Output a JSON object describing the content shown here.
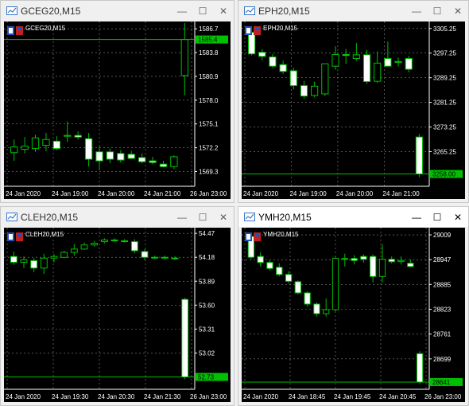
{
  "colors": {
    "background": "#000000",
    "bull_body": "#000000",
    "bear_body": "#ffffff",
    "wick": "#00c000",
    "bid_line": "#00c000",
    "grid": "#8a8a8a",
    "text": "#ffffff"
  },
  "windows": [
    {
      "title": "GCEG20,M15",
      "chart_label": "GCEG20,M15",
      "active": false,
      "controls": {
        "minimize": "—",
        "maximize": "☐",
        "close": "✕"
      },
      "chart_data": {
        "type": "candlestick",
        "title": "GCEG20,M15",
        "ylim": [
          1567.5,
          1587.4
        ],
        "y_ticks": [
          1586.7,
          1583.8,
          1580.9,
          1578.0,
          1575.1,
          1572.2,
          1569.3
        ],
        "x_ticks": [
          "24 Jan 2020",
          "24 Jan 19:00",
          "24 Jan 20:00",
          "24 Jan 21:00",
          "26 Jan 23:00"
        ],
        "last_price": "1585.4",
        "candles": [
          {
            "o": 1571.6,
            "h": 1573.2,
            "l": 1570.6,
            "c": 1572.3
          },
          {
            "o": 1572.0,
            "h": 1573.5,
            "l": 1571.5,
            "c": 1572.4
          },
          {
            "o": 1572.1,
            "h": 1573.8,
            "l": 1571.7,
            "c": 1573.4
          },
          {
            "o": 1572.5,
            "h": 1574.0,
            "l": 1571.8,
            "c": 1573.2
          },
          {
            "o": 1573.0,
            "h": 1573.6,
            "l": 1571.9,
            "c": 1572.1
          },
          {
            "o": 1573.6,
            "h": 1575.4,
            "l": 1572.9,
            "c": 1573.7
          },
          {
            "o": 1573.7,
            "h": 1574.2,
            "l": 1573.2,
            "c": 1573.5
          },
          {
            "o": 1573.3,
            "h": 1574.0,
            "l": 1569.9,
            "c": 1570.8
          },
          {
            "o": 1571.7,
            "h": 1572.4,
            "l": 1569.5,
            "c": 1570.6
          },
          {
            "o": 1571.7,
            "h": 1572.1,
            "l": 1570.3,
            "c": 1570.8
          },
          {
            "o": 1571.5,
            "h": 1571.9,
            "l": 1570.4,
            "c": 1570.7
          },
          {
            "o": 1571.4,
            "h": 1571.8,
            "l": 1570.9,
            "c": 1570.9
          },
          {
            "o": 1571.0,
            "h": 1571.5,
            "l": 1570.3,
            "c": 1570.5
          },
          {
            "o": 1570.6,
            "h": 1571.1,
            "l": 1570.2,
            "c": 1570.4
          },
          {
            "o": 1570.2,
            "h": 1570.6,
            "l": 1569.8,
            "c": 1569.9
          },
          {
            "o": 1569.9,
            "h": 1571.3,
            "l": 1569.6,
            "c": 1571.1
          },
          {
            "o": 1581.0,
            "h": 1587.4,
            "l": 1578.6,
            "c": 1585.4
          }
        ]
      }
    },
    {
      "title": "EPH20,M15",
      "chart_label": "EPH20,M15",
      "active": false,
      "controls": {
        "minimize": "—",
        "maximize": "☐",
        "close": "✕"
      },
      "chart_data": {
        "type": "candlestick",
        "title": "EPH20,M15",
        "ylim": [
          3254.0,
          3307.0
        ],
        "y_ticks": [
          3305.25,
          3297.25,
          3289.25,
          3281.25,
          3273.25,
          3265.25
        ],
        "x_ticks": [
          "24 Jan 2020",
          "24 Jan 19:00",
          "24 Jan 20:00",
          "24 Jan 21:00"
        ],
        "last_price": "3258.00",
        "candles": [
          {
            "o": 3304.0,
            "h": 3305.8,
            "l": 3296.5,
            "c": 3297.0
          },
          {
            "o": 3297.5,
            "h": 3298.5,
            "l": 3295.0,
            "c": 3296.2
          },
          {
            "o": 3296.0,
            "h": 3297.0,
            "l": 3292.5,
            "c": 3293.0
          },
          {
            "o": 3293.5,
            "h": 3294.8,
            "l": 3290.5,
            "c": 3291.3
          },
          {
            "o": 3291.5,
            "h": 3292.5,
            "l": 3285.5,
            "c": 3286.7
          },
          {
            "o": 3286.7,
            "h": 3288.2,
            "l": 3282.5,
            "c": 3283.3
          },
          {
            "o": 3283.5,
            "h": 3288.0,
            "l": 3282.9,
            "c": 3286.5
          },
          {
            "o": 3284.0,
            "h": 3292.6,
            "l": 3283.3,
            "c": 3293.8
          },
          {
            "o": 3293.0,
            "h": 3299.5,
            "l": 3291.8,
            "c": 3296.8
          },
          {
            "o": 3296.8,
            "h": 3298.6,
            "l": 3293.8,
            "c": 3296.5
          },
          {
            "o": 3295.5,
            "h": 3300.5,
            "l": 3294.8,
            "c": 3296.7
          },
          {
            "o": 3296.7,
            "h": 3298.3,
            "l": 3287.2,
            "c": 3288.0
          },
          {
            "o": 3288.1,
            "h": 3297.8,
            "l": 3287.6,
            "c": 3294.0
          },
          {
            "o": 3295.5,
            "h": 3301.0,
            "l": 3294.2,
            "c": 3293.0
          },
          {
            "o": 3294.5,
            "h": 3295.8,
            "l": 3292.9,
            "c": 3294.3
          },
          {
            "o": 3295.5,
            "h": 3296.3,
            "l": 3291.0,
            "c": 3292.0
          },
          {
            "o": 3270.0,
            "h": 3271.0,
            "l": 3257.0,
            "c": 3258.0
          }
        ]
      }
    },
    {
      "title": "CLEH20,M15",
      "chart_label": "CLEH20,M15",
      "active": false,
      "controls": {
        "minimize": "—",
        "maximize": "☐",
        "close": "✕"
      },
      "chart_data": {
        "type": "candlestick",
        "title": "CLEH20,M15",
        "ylim": [
          52.58,
          54.52
        ],
        "y_ticks": [
          54.47,
          54.18,
          53.89,
          53.6,
          53.31,
          53.02
        ],
        "x_ticks": [
          "24 Jan 2020",
          "24 Jan 19:30",
          "24 Jan 20:30",
          "24 Jan 21:30",
          "26 Jan 23:00"
        ],
        "last_price": "52.73",
        "candles": [
          {
            "o": 54.19,
            "h": 54.25,
            "l": 54.09,
            "c": 54.12
          },
          {
            "o": 54.12,
            "h": 54.19,
            "l": 54.05,
            "c": 54.15
          },
          {
            "o": 54.14,
            "h": 54.17,
            "l": 54.0,
            "c": 54.05
          },
          {
            "o": 54.05,
            "h": 54.22,
            "l": 53.98,
            "c": 54.17
          },
          {
            "o": 54.17,
            "h": 54.22,
            "l": 54.12,
            "c": 54.19
          },
          {
            "o": 54.18,
            "h": 54.26,
            "l": 54.17,
            "c": 54.24
          },
          {
            "o": 54.24,
            "h": 54.34,
            "l": 54.2,
            "c": 54.28
          },
          {
            "o": 54.28,
            "h": 54.36,
            "l": 54.27,
            "c": 54.33
          },
          {
            "o": 54.33,
            "h": 54.38,
            "l": 54.31,
            "c": 54.35
          },
          {
            "o": 54.37,
            "h": 54.41,
            "l": 54.35,
            "c": 54.39
          },
          {
            "o": 54.39,
            "h": 54.41,
            "l": 54.37,
            "c": 54.38
          },
          {
            "o": 54.38,
            "h": 54.4,
            "l": 54.36,
            "c": 54.37
          },
          {
            "o": 54.37,
            "h": 54.4,
            "l": 54.23,
            "c": 54.26
          },
          {
            "o": 54.25,
            "h": 54.28,
            "l": 54.15,
            "c": 54.18
          },
          {
            "o": 54.18,
            "h": 54.2,
            "l": 54.16,
            "c": 54.17
          },
          {
            "o": 54.18,
            "h": 54.2,
            "l": 54.16,
            "c": 54.17
          },
          {
            "o": 54.17,
            "h": 54.19,
            "l": 54.15,
            "c": 54.16
          },
          {
            "o": 53.67,
            "h": 53.69,
            "l": 52.7,
            "c": 52.73
          }
        ]
      }
    },
    {
      "title": "YMH20,M15",
      "chart_label": "YMH20,M15",
      "active": true,
      "controls": {
        "minimize": "—",
        "maximize": "☐",
        "close": "✕"
      },
      "chart_data": {
        "type": "candlestick",
        "title": "YMH20,M15",
        "ylim": [
          28623,
          29023
        ],
        "y_ticks": [
          29009,
          28947,
          28885,
          28823,
          28761,
          28699
        ],
        "x_ticks": [
          "24 Jan 2020",
          "24 Jan 18:45",
          "24 Jan 19:45",
          "24 Jan 20:45",
          "26 Jan 23:00"
        ],
        "last_price": "28641",
        "candles": [
          {
            "o": 29005,
            "h": 29012,
            "l": 28948,
            "c": 28953
          },
          {
            "o": 28955,
            "h": 28965,
            "l": 28930,
            "c": 28940
          },
          {
            "o": 28940,
            "h": 28945,
            "l": 28920,
            "c": 28925
          },
          {
            "o": 28928,
            "h": 28938,
            "l": 28905,
            "c": 28910
          },
          {
            "o": 28910,
            "h": 28918,
            "l": 28888,
            "c": 28893
          },
          {
            "o": 28892,
            "h": 28895,
            "l": 28860,
            "c": 28864
          },
          {
            "o": 28864,
            "h": 28868,
            "l": 28830,
            "c": 28836
          },
          {
            "o": 28836,
            "h": 28840,
            "l": 28805,
            "c": 28812
          },
          {
            "o": 28812,
            "h": 28850,
            "l": 28805,
            "c": 28822
          },
          {
            "o": 28822,
            "h": 28955,
            "l": 28818,
            "c": 28950
          },
          {
            "o": 28948,
            "h": 28962,
            "l": 28930,
            "c": 28950
          },
          {
            "o": 28950,
            "h": 28958,
            "l": 28935,
            "c": 28945
          },
          {
            "o": 28955,
            "h": 28960,
            "l": 28940,
            "c": 28948
          },
          {
            "o": 28955,
            "h": 28960,
            "l": 28890,
            "c": 28905
          },
          {
            "o": 28905,
            "h": 28985,
            "l": 28890,
            "c": 28948
          },
          {
            "o": 28948,
            "h": 28955,
            "l": 28938,
            "c": 28942
          },
          {
            "o": 28942,
            "h": 28955,
            "l": 28935,
            "c": 28945
          },
          {
            "o": 28938,
            "h": 28948,
            "l": 28928,
            "c": 28930
          },
          {
            "o": 28712,
            "h": 28718,
            "l": 28636,
            "c": 28641
          }
        ]
      }
    }
  ]
}
